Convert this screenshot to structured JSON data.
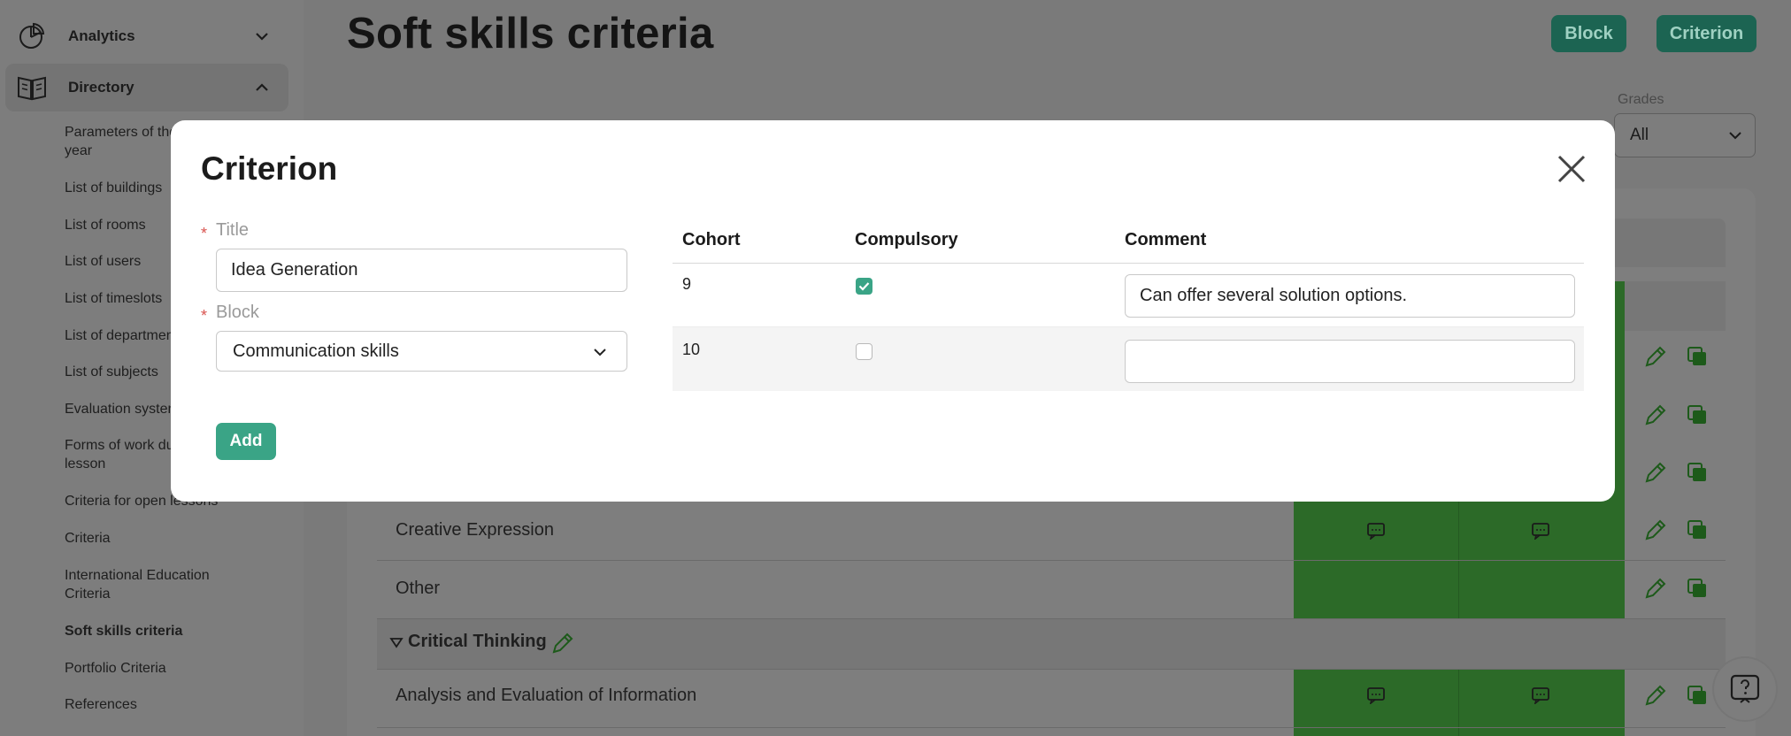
{
  "sidebar": {
    "analytics_label": "Analytics",
    "directory_label": "Directory",
    "sub_items": [
      "Parameters of the school year",
      "List of buildings",
      "List of rooms",
      "List of users",
      "List of timeslots",
      "List of departments",
      "List of subjects",
      "Evaluation system",
      "Forms of work during the lesson",
      "Criteria for open lessons",
      "Criteria",
      "International Education Criteria",
      "Soft skills criteria",
      "Portfolio Criteria",
      "References"
    ],
    "current_item": "Soft skills criteria"
  },
  "header": {
    "title": "Soft skills criteria",
    "block_button": "Block",
    "criterion_button": "Criterion"
  },
  "filters": {
    "grades_label": "Grades",
    "grades_value": "All"
  },
  "table": {
    "rows": [
      "Creative Expression",
      "Other",
      "Analysis and Evaluation of Information"
    ],
    "group_name": "Critical Thinking"
  },
  "modal": {
    "title": "Criterion",
    "title_label": "Title",
    "title_value": "Idea Generation",
    "block_label": "Block",
    "block_value": "Communication skills",
    "add_button": "Add",
    "columns": {
      "cohort": "Cohort",
      "compulsory": "Compulsory",
      "comment": "Comment"
    },
    "rows": [
      {
        "cohort": "9",
        "compulsory": true,
        "comment": "Can offer several solution options."
      },
      {
        "cohort": "10",
        "compulsory": false,
        "comment": ""
      }
    ]
  },
  "colors": {
    "accent": "#3aa486",
    "accent_dark": "#1c6452",
    "green_column": "#2c6a28"
  },
  "icons": [
    "analytics-icon",
    "directory-icon",
    "chevron-down-icon",
    "chevron-up-icon",
    "close-icon",
    "pencil-icon",
    "copy-icon",
    "comment-icon",
    "help-icon",
    "check-icon"
  ]
}
